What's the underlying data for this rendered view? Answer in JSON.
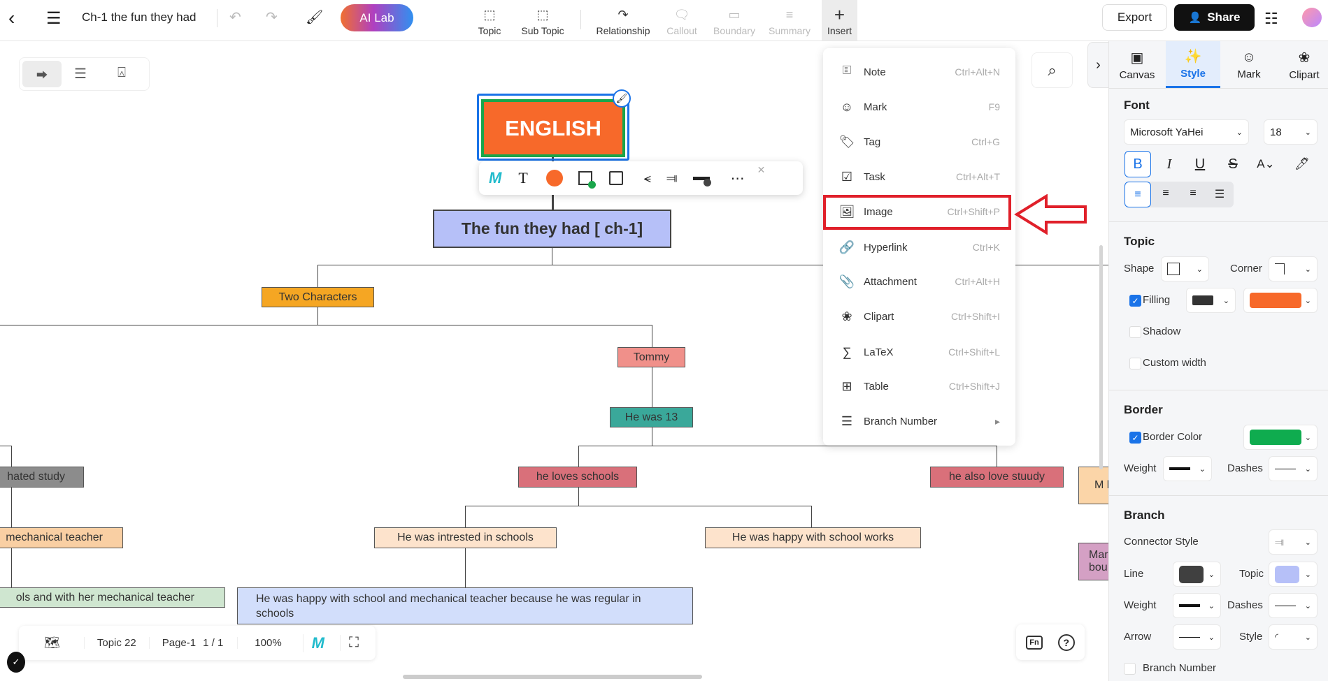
{
  "header": {
    "title": "Ch-1 the fun they had",
    "ai_lab": "AI Lab",
    "export": "Export",
    "share": "Share",
    "tools": [
      {
        "label": "Topic",
        "icon": "topic-icon"
      },
      {
        "label": "Sub Topic",
        "icon": "subtopic-icon"
      },
      {
        "label": "Relationship",
        "icon": "relationship-icon"
      },
      {
        "label": "Callout",
        "icon": "callout-icon",
        "disabled": true
      },
      {
        "label": "Boundary",
        "icon": "boundary-icon",
        "disabled": true
      },
      {
        "label": "Summary",
        "icon": "summary-icon",
        "disabled": true
      },
      {
        "label": "Insert",
        "icon": "plus-icon",
        "active": true
      }
    ]
  },
  "insert_menu": {
    "highlighted": "Image",
    "items": [
      {
        "label": "Note",
        "shortcut": "Ctrl+Alt+N"
      },
      {
        "label": "Mark",
        "shortcut": "F9"
      },
      {
        "label": "Tag",
        "shortcut": "Ctrl+G"
      },
      {
        "label": "Task",
        "shortcut": "Ctrl+Alt+T"
      },
      {
        "label": "Image",
        "shortcut": "Ctrl+Shift+P"
      },
      {
        "label": "Hyperlink",
        "shortcut": "Ctrl+K"
      },
      {
        "label": "Attachment",
        "shortcut": "Ctrl+Alt+H"
      },
      {
        "label": "Clipart",
        "shortcut": "Ctrl+Shift+I"
      },
      {
        "label": "LaTeX",
        "shortcut": "Ctrl+Shift+L"
      },
      {
        "label": "Table",
        "shortcut": "Ctrl+Shift+J"
      },
      {
        "label": "Branch Number",
        "shortcut": ""
      }
    ]
  },
  "map": {
    "root": "ENGLISH",
    "main": "The fun they had [ ch-1]",
    "nodes": {
      "two_characters": "Two Characters",
      "tommy": "Tommy",
      "he_was_13": "He was 13",
      "hated_study": "hated study",
      "he_loves_schools": "he loves schools",
      "he_also_love": "he also love stuudy",
      "mechanical_teacher": "mechanical teacher",
      "intrested": "He was intrested in schools",
      "happy_works": "He was happy with school works",
      "schools_with_her": "ols and with her mechanical teacher",
      "happy_long": "He was happy with school and mechanical teacher because he was regular in schools",
      "partial_1": "M ho",
      "partial_2": "Mar bou"
    },
    "colors": {
      "root_fill": "#f7692a",
      "root_border": "#1aa64b",
      "main_fill": "#b6c0f8"
    }
  },
  "bottom": {
    "topic_count": "Topic 22",
    "page": "Page-1",
    "page_count": "1 / 1",
    "zoom": "100%"
  },
  "panel": {
    "tabs": [
      "Canvas",
      "Style",
      "Mark",
      "Clipart"
    ],
    "active_tab": "Style",
    "font": {
      "heading": "Font",
      "family": "Microsoft YaHei",
      "size": "18",
      "bold": true,
      "align": "left"
    },
    "topic": {
      "heading": "Topic",
      "shape": "Shape",
      "corner": "Corner",
      "filling": "Filling",
      "filling_checked": true,
      "fill_color": "#f7692a",
      "shadow": "Shadow",
      "custom_width": "Custom width"
    },
    "border": {
      "heading": "Border",
      "color_label": "Border Color",
      "checked": true,
      "color": "#0fac4f",
      "weight": "Weight",
      "dashes": "Dashes"
    },
    "branch": {
      "heading": "Branch",
      "connector": "Connector Style",
      "line": "Line",
      "line_color": "#404040",
      "topic": "Topic",
      "topic_color": "#b6c0f8",
      "weight": "Weight",
      "dashes": "Dashes",
      "arrow": "Arrow",
      "style": "Style",
      "branch_number": "Branch Number"
    }
  }
}
